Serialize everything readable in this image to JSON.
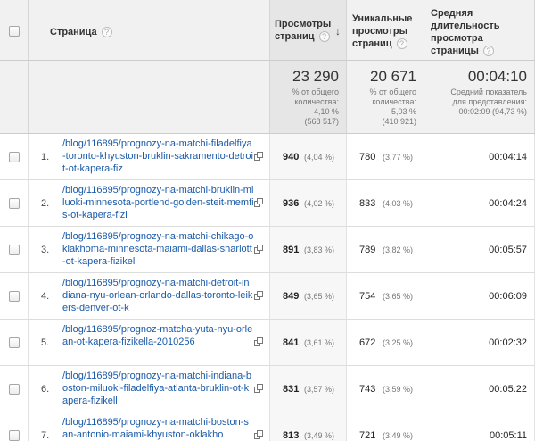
{
  "header": {
    "page_label": "Страница",
    "views_label_1": "Просмотры",
    "views_label_2": "страниц",
    "uniq_label_1": "Уникальные",
    "uniq_label_2": "просмотры",
    "uniq_label_3": "страниц",
    "time_label_1": "Средняя",
    "time_label_2": "длительность",
    "time_label_3": "просмотра",
    "time_label_4": "страницы",
    "help_glyph": "?",
    "sort_glyph": "↓"
  },
  "totals": {
    "views": "23 290",
    "views_note_1": "% от общего",
    "views_note_2": "количества:",
    "views_note_3": "4,10 %",
    "views_note_4": "(568 517)",
    "uniq": "20 671",
    "uniq_note_1": "% от общего",
    "uniq_note_2": "количества:",
    "uniq_note_3": "5,03 %",
    "uniq_note_4": "(410 921)",
    "time": "00:04:10",
    "time_note_1": "Средний показатель",
    "time_note_2": "для представления:",
    "time_note_3": "00:02:09 (94,73 %)"
  },
  "rows": [
    {
      "rank": "1.",
      "link": "/blog/116895/prognozy-na-matchi-filadelfiya-toronto-khyuston-bruklin-sakramento-detroit-ot-kapera-fiz",
      "views": "940",
      "views_pct": "(4,04 %)",
      "uniq": "780",
      "uniq_pct": "(3,77 %)",
      "time": "00:04:14"
    },
    {
      "rank": "2.",
      "link": "/blog/116895/prognozy-na-matchi-bruklin-miluoki-minnesota-portlend-golden-steit-memfis-ot-kapera-fizi",
      "views": "936",
      "views_pct": "(4,02 %)",
      "uniq": "833",
      "uniq_pct": "(4,03 %)",
      "time": "00:04:24"
    },
    {
      "rank": "3.",
      "link": "/blog/116895/prognozy-na-matchi-chikago-oklakhoma-minnesota-maiami-dallas-sharlott-ot-kapera-fizikell",
      "views": "891",
      "views_pct": "(3,83 %)",
      "uniq": "789",
      "uniq_pct": "(3,82 %)",
      "time": "00:05:57"
    },
    {
      "rank": "4.",
      "link": "/blog/116895/prognozy-na-matchi-detroit-indiana-nyu-orlean-orlando-dallas-toronto-leikers-denver-ot-k",
      "views": "849",
      "views_pct": "(3,65 %)",
      "uniq": "754",
      "uniq_pct": "(3,65 %)",
      "time": "00:06:09"
    },
    {
      "rank": "5.",
      "link": "/blog/116895/prognoz-matcha-yuta-nyu-orlean-ot-kapera-fizikella-2010256",
      "views": "841",
      "views_pct": "(3,61 %)",
      "uniq": "672",
      "uniq_pct": "(3,25 %)",
      "time": "00:02:32"
    },
    {
      "rank": "6.",
      "link": "/blog/116895/prognozy-na-matchi-indiana-boston-miluoki-filadelfiya-atlanta-bruklin-ot-kapera-fizikell",
      "views": "831",
      "views_pct": "(3,57 %)",
      "uniq": "743",
      "uniq_pct": "(3,59 %)",
      "time": "00:05:22"
    },
    {
      "rank": "7.",
      "link": "/blog/116895/prognozy-na-matchi-boston-san-antonio-maiami-khyuston-oklakho",
      "views": "813",
      "views_pct": "(3,49 %)",
      "uniq": "721",
      "uniq_pct": "(3,49 %)",
      "time": "00:05:11"
    }
  ]
}
